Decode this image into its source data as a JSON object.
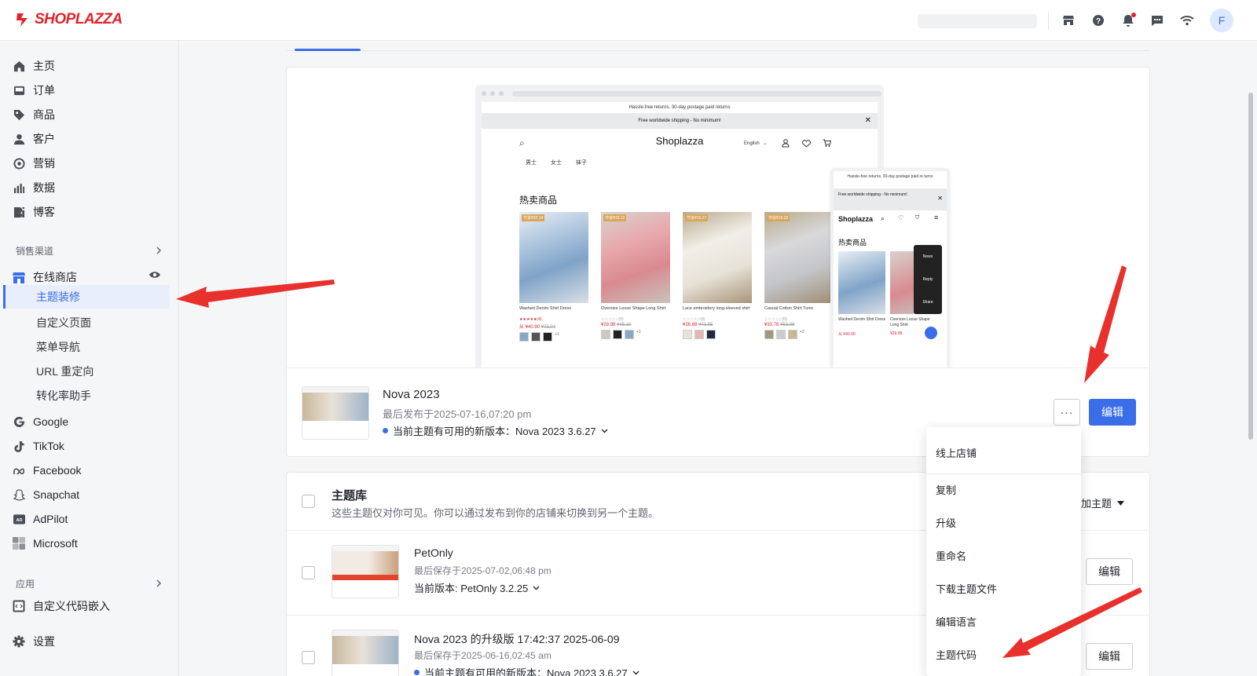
{
  "brand": {
    "name": "SHOPLAZZA",
    "color": "#e0242b"
  },
  "header": {
    "icons": [
      "store-icon",
      "help-icon",
      "bell-icon",
      "message-icon",
      "wifi-icon"
    ],
    "avatar_letter": "F"
  },
  "sidebar": {
    "items": [
      {
        "label": "主页",
        "icon": "home-icon"
      },
      {
        "label": "订单",
        "icon": "inbox-icon"
      },
      {
        "label": "商品",
        "icon": "tag-icon"
      },
      {
        "label": "客户",
        "icon": "person-icon"
      },
      {
        "label": "营销",
        "icon": "target-icon"
      },
      {
        "label": "数据",
        "icon": "bar-chart-icon"
      },
      {
        "label": "博客",
        "icon": "blog-icon"
      }
    ],
    "sales_channels_title": "销售渠道",
    "online_store": "在线商店",
    "online_store_sub": [
      "主题装修",
      "自定义页面",
      "菜单导航",
      "URL 重定向",
      "转化率助手"
    ],
    "channels": [
      "Google",
      "TikTok",
      "Facebook",
      "Snapchat",
      "AdPilot",
      "Microsoft"
    ],
    "apps_title": "应用",
    "custom_code": "自定义代码嵌入",
    "settings": "设置"
  },
  "preview": {
    "announcement": "Hassle-free returns. 30-day postage paid returns",
    "shipping_bar": "Free worldwide shipping - No minimum!",
    "store_name": "Shoplazza",
    "language": "English",
    "nav_links": [
      "男士",
      "女士",
      "袜子"
    ],
    "hot_title": "热卖商品",
    "products": [
      {
        "tag": "节省¥32.14",
        "name": "Washed Denim Shirt Dress",
        "stars": "★★★★★(4)",
        "price": "从 ¥40.90",
        "old": "¥73.04",
        "more": "+1"
      },
      {
        "tag": "节省¥15.12",
        "name": "Oversize Loose Shape Long Shirt",
        "stars": "☆☆☆☆☆(0)",
        "price": "¥29.98",
        "old": "¥45.10",
        "more": "+1"
      },
      {
        "tag": "节省¥15.27",
        "name": "Lace embroidery long-sleeved shirt",
        "stars": "☆☆☆☆☆(0)",
        "price": "¥26.68",
        "old": "¥41.95",
        "more": ""
      },
      {
        "tag": "节省¥19.32",
        "name": "Casual Cotton Shirt Tunic",
        "stars": "☆☆☆☆☆(0)",
        "price": "¥33.76",
        "old": "¥53.08",
        "more": "+2"
      }
    ],
    "mobile_announcement": "Hassle-free returns. 30-day postage paid re turns",
    "mobile_shipping": "Free worldwide shipping - No minimum!",
    "mobile_social": [
      "News",
      "Reply",
      "Share"
    ],
    "mobile_products": [
      {
        "name": "Washed Denim Shirt Dress",
        "price": "从 ¥40.90",
        "old": "¥73.04"
      },
      {
        "name": "Oversize Loose Shape Long Shirt",
        "price": "¥29.98",
        "old": "¥45"
      }
    ]
  },
  "current_theme": {
    "name": "Nova 2023",
    "date": "最后发布于2025-07-16,07:20 pm",
    "update": "当前主题有可用的新版本：Nova 2023 3.6.27",
    "more_label": "···",
    "edit_label": "编辑"
  },
  "dropdown": {
    "items": [
      "线上店铺",
      "复制",
      "升级",
      "重命名",
      "下载主题文件",
      "编辑语言",
      "主题代码"
    ]
  },
  "library": {
    "title": "主题库",
    "desc": "这些主题仅对你可见。你可以通过发布到你的店铺来切换到另一个主题。",
    "add_label": "加主题",
    "themes": [
      {
        "name": "PetOnly",
        "date": "最后保存于2025-07-02,06:48 pm",
        "version": "当前版本: PetOnly 3.2.25",
        "edit": "编辑"
      },
      {
        "name": "Nova 2023 的升级版 17:42:37 2025-06-09",
        "date": "最后保存于2025-06-16,02:45 am",
        "version": "当前主题有可用的新版本：Nova 2023 3.6.27",
        "edit": "编辑"
      }
    ]
  },
  "colors": {
    "accent": "#3a6ee8",
    "annotation_arrow": "#e8302c"
  }
}
